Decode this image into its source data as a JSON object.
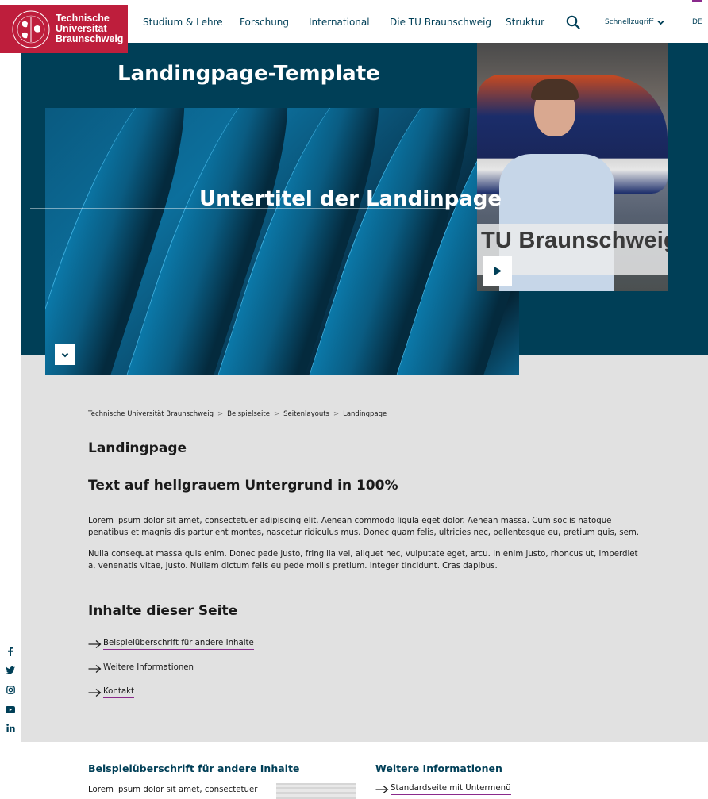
{
  "header": {
    "logo_lines": [
      "Technische",
      "Universität",
      "Braunschweig"
    ],
    "nav": [
      {
        "label": "Studium & Lehre"
      },
      {
        "label": "Forschung"
      },
      {
        "label": "International"
      },
      {
        "label": "Die TU Braunschweig"
      },
      {
        "label": "Struktur"
      }
    ],
    "search_icon": "search-icon",
    "quick_access": "Schnellzugriff",
    "language": "DE"
  },
  "hero": {
    "title_bold": "Landingpage",
    "title_rest": "-Template",
    "subtitle": "Untertitel der Landinpage",
    "scroll_icon": "chevron-down-icon",
    "video": {
      "title": "TU Braunschweig",
      "play_icon": "play-icon"
    }
  },
  "breadcrumb": [
    "Technische Universität Braunschweig",
    "Beispielseite",
    "Seitenlayouts",
    "Landingpage"
  ],
  "breadcrumb_separator": ">",
  "main": {
    "page_heading": "Landingpage",
    "section_heading": "Text auf hellgrauem Untergrund in 100%",
    "paragraphs": [
      "Lorem ipsum dolor sit amet, consectetuer adipiscing elit. Aenean commodo ligula eget dolor. Aenean massa. Cum sociis natoque penatibus et magnis dis parturient montes, nascetur ridiculus mus. Donec quam felis, ultricies nec, pellentesque eu, pretium quis, sem.",
      "Nulla consequat massa quis enim. Donec pede justo, fringilla vel, aliquet nec, vulputate eget, arcu. In enim justo, rhoncus ut, imperdiet a, venenatis vitae, justo. Nullam dictum felis eu pede mollis pretium. Integer tincidunt. Cras dapibus."
    ],
    "contents_heading": "Inhalte dieser Seite",
    "contents_links": [
      "Beispielüberschrift für andere Inhalte",
      "Weitere Informationen",
      "Kontakt"
    ]
  },
  "social": [
    "facebook-icon",
    "twitter-icon",
    "instagram-icon",
    "youtube-icon",
    "linkedin-icon"
  ],
  "bottom": {
    "left_heading": "Beispielüberschrift für andere Inhalte",
    "left_text": "Lorem ipsum dolor sit amet, consectetuer",
    "right_heading": "Weitere Informationen",
    "right_link": "Standardseite mit Untermenü"
  },
  "colors": {
    "brand_red": "#be1e3c",
    "brand_blue": "#003f57",
    "link_underline": "#8a2a8c",
    "content_grey": "#e1e1e1"
  }
}
